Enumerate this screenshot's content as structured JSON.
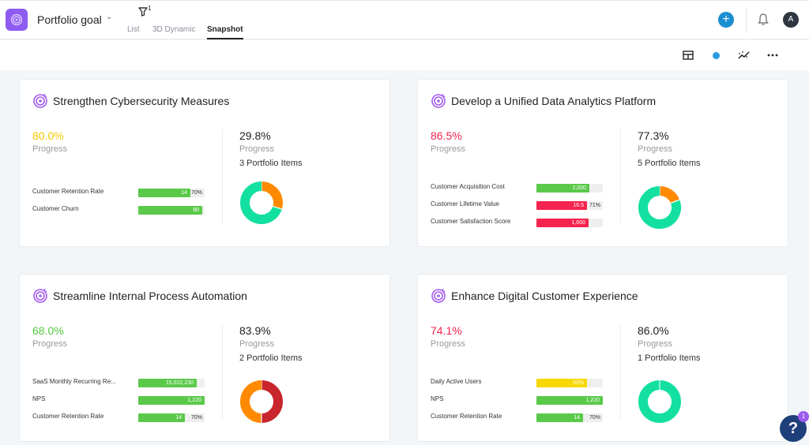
{
  "header": {
    "title": "Portfolio goal",
    "filter_count": "1",
    "tabs": [
      {
        "label": "List",
        "active": false
      },
      {
        "label": "3D Dynamic",
        "active": false
      },
      {
        "label": "Snapshot",
        "active": true
      }
    ],
    "avatar_initial": "A",
    "add_icon": "plus-icon",
    "notification_icon": "bell-icon"
  },
  "toolbar": {
    "icons": [
      "layout-icon",
      "status-dot-icon",
      "trend-icon",
      "more-icon"
    ],
    "accent": "#2a9be0"
  },
  "colors": {
    "green": "#5ac94a",
    "red": "#f5234f",
    "yellow": "#f7d800",
    "donut_teal": "#13e0a0",
    "donut_orange": "#ff8a00",
    "donut_red": "#c8262c",
    "pct_yellow": "#f5c800",
    "pct_red": "#f5234f",
    "pct_green": "#52c83e"
  },
  "cards": [
    {
      "title": "Strengthen Cybersecurity Measures",
      "left_pct": "80.0%",
      "left_pct_color": "#f5c800",
      "left_label": "Progress",
      "right_pct": "29.8%",
      "right_label": "Progress",
      "right_items": "3 Portfolio Items",
      "metrics": [
        {
          "name": "Customer Retention Rate",
          "value": "14",
          "pct": "70%",
          "fill": 0.78,
          "color": "#5ac94a"
        },
        {
          "name": "Customer Churn",
          "value": "90",
          "pct": "",
          "fill": 0.97,
          "color": "#5ac94a"
        }
      ],
      "donut": [
        {
          "value": 0.298,
          "color": "#ff8a00"
        },
        {
          "value": 0.702,
          "color": "#13e0a0"
        }
      ]
    },
    {
      "title": "Develop a Unified Data Analytics Platform",
      "left_pct": "86.5%",
      "left_pct_color": "#f5234f",
      "left_label": "Progress",
      "right_pct": "77.3%",
      "right_label": "Progress",
      "right_items": "5 Portfolio Items",
      "metrics": [
        {
          "name": "Customer Acquisition Cost",
          "value": "2,000",
          "pct": "",
          "fill": 0.8,
          "color": "#5ac94a"
        },
        {
          "name": "Customer Lifetime Value",
          "value": "16.5",
          "pct": "71%",
          "fill": 0.76,
          "color": "#f5234f"
        },
        {
          "name": "Customer Satisfaction Score",
          "value": "1,600",
          "pct": "",
          "fill": 0.78,
          "color": "#f5234f"
        }
      ],
      "donut": [
        {
          "value": 0.19,
          "color": "#ff8a00"
        },
        {
          "value": 0.81,
          "color": "#13e0a0"
        }
      ]
    },
    {
      "title": "Streamline Internal Process Automation",
      "left_pct": "68.0%",
      "left_pct_color": "#52c83e",
      "left_label": "Progress",
      "right_pct": "83.9%",
      "right_label": "Progress",
      "right_items": "2 Portfolio Items",
      "metrics": [
        {
          "name": "SaaS Monthly Recurring Re...",
          "value": "15,022,230",
          "pct": "",
          "fill": 0.88,
          "color": "#5ac94a"
        },
        {
          "name": "NPS",
          "value": "1,220",
          "pct": "",
          "fill": 1.0,
          "color": "#5ac94a"
        },
        {
          "name": "Customer Retention Rate",
          "value": "14",
          "pct": "70%",
          "fill": 0.7,
          "color": "#5ac94a"
        }
      ],
      "donut": [
        {
          "value": 0.5,
          "color": "#c8262c"
        },
        {
          "value": 0.5,
          "color": "#ff8a00"
        }
      ]
    },
    {
      "title": "Enhance Digital Customer Experience",
      "left_pct": "74.1%",
      "left_pct_color": "#f5234f",
      "left_label": "Progress",
      "right_pct": "86.0%",
      "right_label": "Progress",
      "right_items": "1 Portfolio Items",
      "metrics": [
        {
          "name": "Daily Active Users",
          "value": "50%",
          "pct": "",
          "fill": 0.76,
          "color": "#f7d800"
        },
        {
          "name": "NPS",
          "value": "1,220",
          "pct": "",
          "fill": 1.0,
          "color": "#5ac94a"
        },
        {
          "name": "Customer Retention Rate",
          "value": "14",
          "pct": "70%",
          "fill": 0.7,
          "color": "#5ac94a"
        }
      ],
      "donut": [
        {
          "value": 1.0,
          "color": "#13e0a0"
        }
      ]
    }
  ],
  "help": {
    "label": "?",
    "badge": "1"
  }
}
